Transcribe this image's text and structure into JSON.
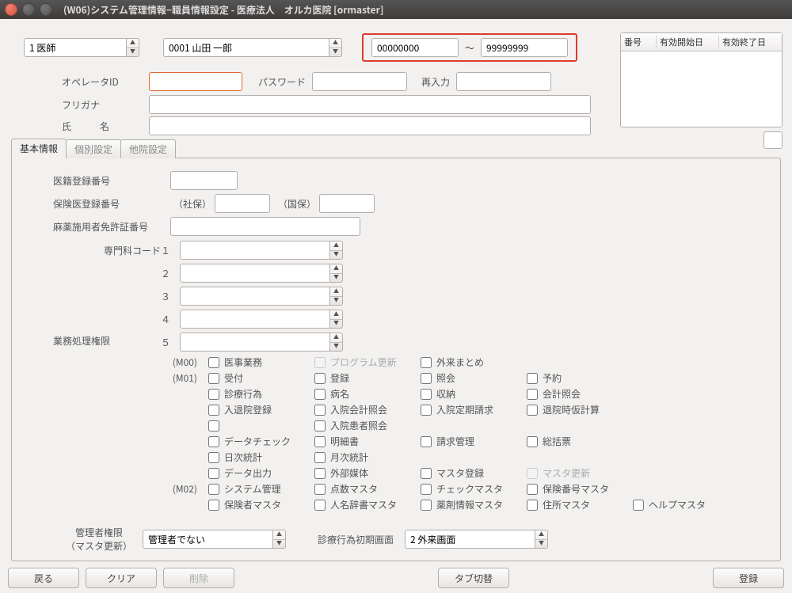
{
  "title": "(W06)システム管理情報−職員情報設定 - 医療法人　オルカ医院  [ormaster]",
  "top": {
    "type_value": "1 医師",
    "staff_value": "0001 山田 一郎",
    "date_from": "00000000",
    "date_to": "99999999",
    "tilde": "～"
  },
  "list_headers": {
    "no": "番号",
    "start": "有効開始日",
    "end": "有効終了日"
  },
  "labels": {
    "operator_id": "オペレータID",
    "password": "パスワード",
    "reenter": "再入力",
    "furigana": "フリガナ",
    "name": "氏　　　名"
  },
  "tabs": {
    "basic": "基本情報",
    "indiv": "個別設定",
    "other": "他院設定"
  },
  "basic": {
    "med_reg": "医籍登録番号",
    "ins_reg": "保険医登録番号",
    "shaho": "（社保）",
    "kokuho": "（国保）",
    "narcotic": "麻薬施用者免許証番号",
    "spec_code": "専門科コード１",
    "s2": "２",
    "s3": "３",
    "s4": "４",
    "s5": "５",
    "perm_label": "業務処理権限",
    "m00": "(M00)",
    "m01": "(M01)",
    "m02": "(M02)",
    "chk": {
      "ijigyomu": "医事業務",
      "prog_update": "プログラム更新",
      "gairai": "外来まとめ",
      "uketsuke": "受付",
      "touroku": "登録",
      "shoukai": "照会",
      "yoyaku": "予約",
      "shinryo": "診療行為",
      "byoumei": "病名",
      "shuunou": "収納",
      "kaikei_shoukai": "会計照会",
      "nyutaiin": "入退院登録",
      "nyuin_kaikei": "入院会計照会",
      "nyuin_teiki": "入院定期請求",
      "taiin_kari": "退院時仮計算",
      "nyuin_kanja": "入院患者照会",
      "data_check": "データチェック",
      "meisai": "明細書",
      "seikyu": "請求管理",
      "soukatsu": "総括票",
      "nichiji": "日次統計",
      "getsuji": "月次統計",
      "data_out": "データ出力",
      "gaibu": "外部媒体",
      "master_reg": "マスタ登録",
      "master_update": "マスタ更新",
      "sys_kanri": "システム管理",
      "tensu": "点数マスタ",
      "check_master": "チェックマスタ",
      "hoken_no": "保険番号マスタ",
      "hokensha": "保険者マスタ",
      "jinmei": "人名辞書マスタ",
      "yakuzai": "薬剤情報マスタ",
      "jusho": "住所マスタ",
      "help": "ヘルプマスタ"
    },
    "admin_label": "管理者権限",
    "admin_sub": "（マスタ更新）",
    "admin_value": "管理者でない",
    "init_screen_label": "診療行為初期画面",
    "init_screen_value": "2 外来画面"
  },
  "buttons": {
    "back": "戻る",
    "clear": "クリア",
    "delete": "削除",
    "tab": "タブ切替",
    "register": "登録"
  }
}
